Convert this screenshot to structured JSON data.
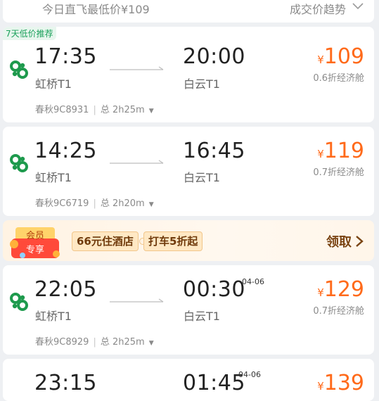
{
  "header": {
    "left_text": "今日直飞最低价¥109",
    "right_text": "成交价趋势"
  },
  "colors": {
    "price": "#ff6a1a",
    "airline_green": "#1e9a4d",
    "tag_green": "#1aa05a"
  },
  "flights": [
    {
      "tag": "7天低价推荐",
      "dep_time": "17:35",
      "dep_airport": "虹桥T1",
      "arr_time": "20:00",
      "arr_airport": "白云T1",
      "next_day": "",
      "currency": "¥",
      "price": "109",
      "cabin": "0.6折经济舱",
      "flight_no": "春秋9C8931",
      "duration": "总 2h25m"
    },
    {
      "tag": "",
      "dep_time": "14:25",
      "dep_airport": "虹桥T1",
      "arr_time": "16:45",
      "arr_airport": "白云T1",
      "next_day": "",
      "currency": "¥",
      "price": "119",
      "cabin": "0.7折经济舱",
      "flight_no": "春秋9C6719",
      "duration": "总 2h20m"
    },
    {
      "tag": "",
      "dep_time": "22:05",
      "dep_airport": "虹桥T1",
      "arr_time": "00:30",
      "arr_airport": "白云T1",
      "next_day": "04-06",
      "currency": "¥",
      "price": "129",
      "cabin": "0.7折经济舱",
      "flight_no": "春秋9C8929",
      "duration": "总 2h25m"
    },
    {
      "tag": "",
      "dep_time": "23:15",
      "dep_airport": "",
      "arr_time": "01:45",
      "arr_airport": "",
      "next_day": "04-06",
      "currency": "¥",
      "price": "139",
      "cabin": "",
      "flight_no": "",
      "duration": ""
    }
  ],
  "promo": {
    "badge_top": "会员",
    "badge_bottom": "专享",
    "chip1": "66元住酒店",
    "chip2": "打车5折起",
    "claim": "领取"
  }
}
